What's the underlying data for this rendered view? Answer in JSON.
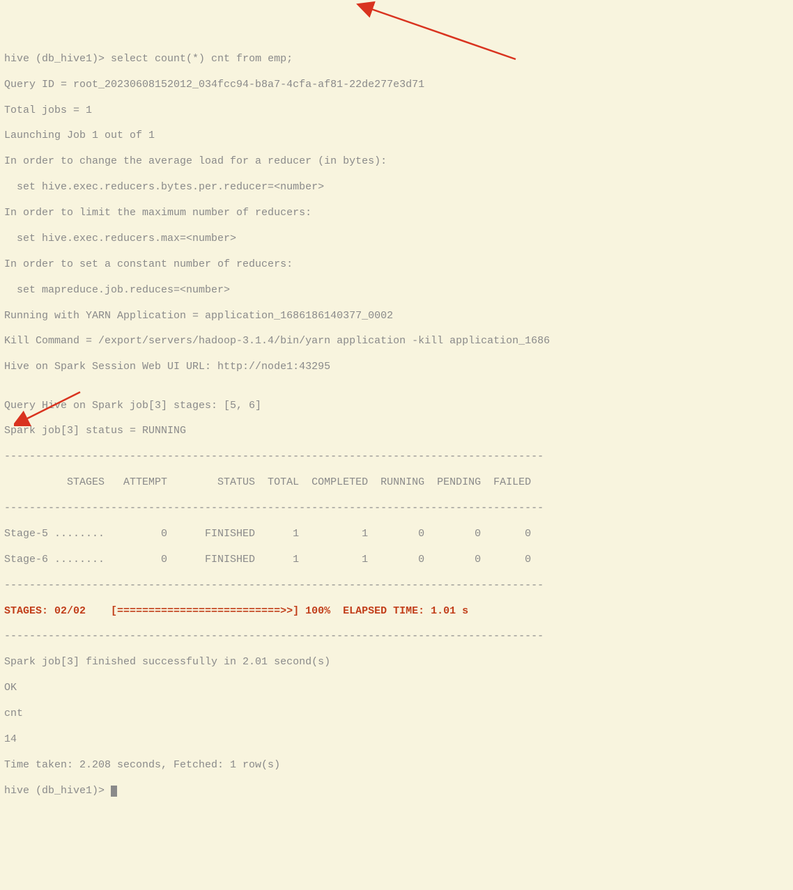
{
  "prompt1": "hive (db_hive1)> ",
  "command": "select count(*) cnt from emp;",
  "l_queryid": "Query ID = root_20230608152012_034fcc94-b8a7-4cfa-af81-22de277e3d71",
  "l_totaljobs": "Total jobs = 1",
  "l_launch": "Launching Job 1 out of 1",
  "l_avgload": "In order to change the average load for a reducer (in bytes):",
  "l_setbytes": "  set hive.exec.reducers.bytes.per.reducer=<number>",
  "l_limitmax": "In order to limit the maximum number of reducers:",
  "l_setmax": "  set hive.exec.reducers.max=<number>",
  "l_setconst": "In order to set a constant number of reducers:",
  "l_setreduces": "  set mapreduce.job.reduces=<number>",
  "l_running": "Running with YARN Application = application_1686186140377_0002",
  "l_kill": "Kill Command = /export/servers/hadoop-3.1.4/bin/yarn application -kill application_1686",
  "l_webui": "Hive on Spark Session Web UI URL: http://node1:43295",
  "l_blank1": "",
  "l_queryhive": "Query Hive on Spark job[3] stages: [5, 6]",
  "l_sparkstatus": "Spark job[3] status = RUNNING",
  "l_dash1": "--------------------------------------------------------------------------------------",
  "l_header": "          STAGES   ATTEMPT        STATUS  TOTAL  COMPLETED  RUNNING  PENDING  FAILED",
  "l_dash2": "--------------------------------------------------------------------------------------",
  "l_stage5": "Stage-5 ........         0      FINISHED      1          1        0        0       0",
  "l_stage6": "Stage-6 ........         0      FINISHED      1          1        0        0       0",
  "l_dash3": "--------------------------------------------------------------------------------------",
  "l_progress": "STAGES: 02/02    [==========================>>] 100%  ELAPSED TIME: 1.01 s    ",
  "l_dash4": "--------------------------------------------------------------------------------------",
  "l_finished": "Spark job[3] finished successfully in 2.01 second(s)",
  "l_ok": "OK",
  "l_cnt": "cnt",
  "l_result": "14",
  "l_timetaken": "Time taken: 2.208 seconds, Fetched: 1 row(s)",
  "prompt2": "hive (db_hive1)> "
}
